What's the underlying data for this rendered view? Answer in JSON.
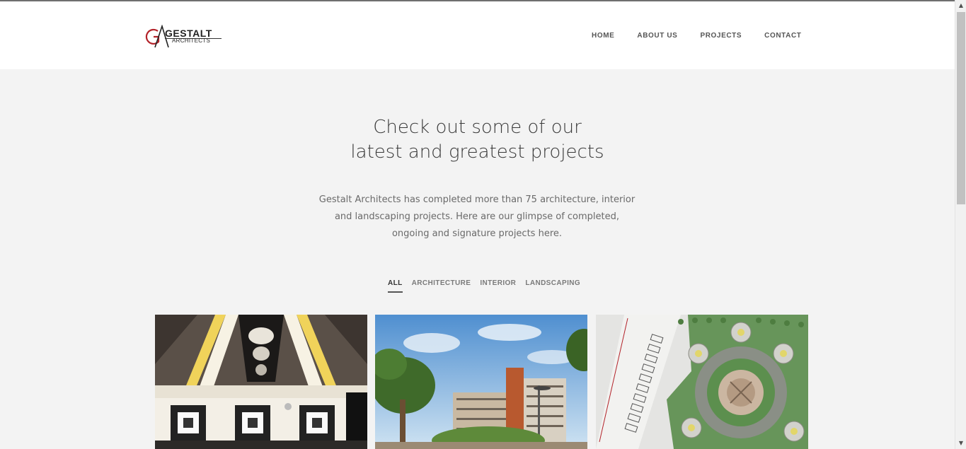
{
  "header": {
    "logo": {
      "brand": "GESTALT",
      "sub": "ARCHITECTS"
    },
    "nav": [
      {
        "label": "HOME"
      },
      {
        "label": "ABOUT US"
      },
      {
        "label": "PROJECTS"
      },
      {
        "label": "CONTACT"
      }
    ]
  },
  "hero": {
    "title_line1": "Check out some of our",
    "title_line2": "latest and greatest projects",
    "text": "Gestalt Architects has completed more than 75 architecture, interior and landscaping projects. Here are our glimpse of completed, ongoing and signature projects here."
  },
  "filters": {
    "all": "ALL",
    "architecture": "ARCHITECTURE",
    "interior": "INTERIOR",
    "landscaping": "LANDSCAPING",
    "active": "ALL"
  },
  "projects": [
    {
      "kind": "interior"
    },
    {
      "kind": "architecture"
    },
    {
      "kind": "landscaping"
    }
  ],
  "colors": {
    "logo_red": "#b3232a",
    "accent_gold": "#e6c54a",
    "page_bg": "#f3f3f3"
  },
  "icons": {
    "scroll_up": "▲",
    "scroll_down": "▼"
  }
}
